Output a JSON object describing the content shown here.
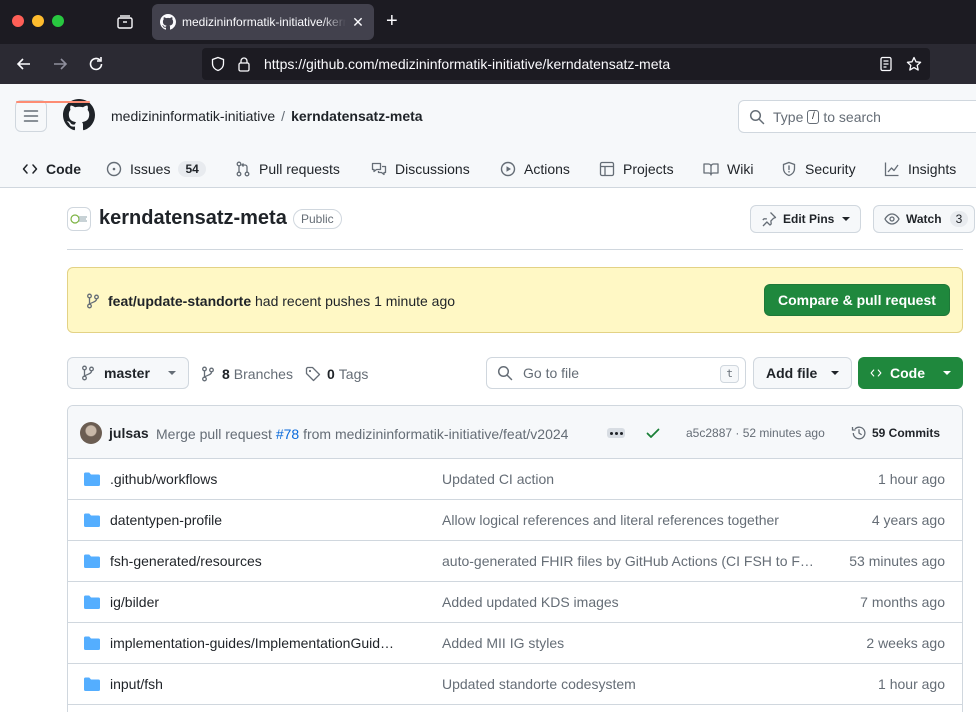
{
  "browser": {
    "tab_title": "medizininformatik-initiative/kerndatensatz-meta",
    "url": "https://github.com/medizininformatik-initiative/kerndatensatz-meta",
    "newtab_label": "+",
    "close_label": "✕"
  },
  "header": {
    "owner": "medizininformatik-initiative",
    "separator": "/",
    "repo": "kerndatensatz-meta",
    "search_prefix": "Type",
    "search_key": "/",
    "search_suffix": "to search"
  },
  "reponav": {
    "code": "Code",
    "issues": "Issues",
    "issues_count": "54",
    "pulls": "Pull requests",
    "discussions": "Discussions",
    "actions": "Actions",
    "projects": "Projects",
    "wiki": "Wiki",
    "security": "Security",
    "insights": "Insights"
  },
  "repo": {
    "name": "kerndatensatz-meta",
    "visibility": "Public",
    "edit_pins": "Edit Pins",
    "watch": "Watch",
    "watch_count": "3"
  },
  "banner": {
    "branch": "feat/update-standorte",
    "text": "had recent pushes 1 minute ago",
    "button": "Compare & pull request"
  },
  "filenav": {
    "branch": "master",
    "branches_count": "8",
    "branches_label": "Branches",
    "tags_count": "0",
    "tags_label": "Tags",
    "goto_placeholder": "Go to file",
    "goto_key": "t",
    "add_file": "Add file",
    "code": "Code"
  },
  "commit": {
    "author": "julsas",
    "msg_prefix": "Merge pull request",
    "pr": "#78",
    "msg_suffix": "from medizininformatik-initiative/feat/v2024",
    "sha_time": "a5c2887 · 52 minutes ago",
    "commits": "59 Commits"
  },
  "files": [
    {
      "name": ".github/workflows",
      "message": "Updated CI action",
      "date": "1 hour ago"
    },
    {
      "name": "datentypen-profile",
      "message": "Allow logical references and literal references together",
      "date": "4 years ago"
    },
    {
      "name": "fsh-generated/resources",
      "message": "auto-generated FHIR files by GitHub Actions (CI FSH to F…",
      "date": "53 minutes ago"
    },
    {
      "name": "ig/bilder",
      "message": "Added updated KDS images",
      "date": "7 months ago"
    },
    {
      "name": "implementation-guides/ImplementationGuid…",
      "message": "Added MII IG styles",
      "date": "2 weeks ago"
    },
    {
      "name": "input/fsh",
      "message": "Updated standorte codesystem",
      "date": "1 hour ago"
    }
  ],
  "colors": {
    "accent_green": "#1f883d",
    "link_blue": "#0969da",
    "folder_blue": "#54aeff",
    "banner_bg": "#fff8c5",
    "tab_underline": "#fd8c73"
  }
}
